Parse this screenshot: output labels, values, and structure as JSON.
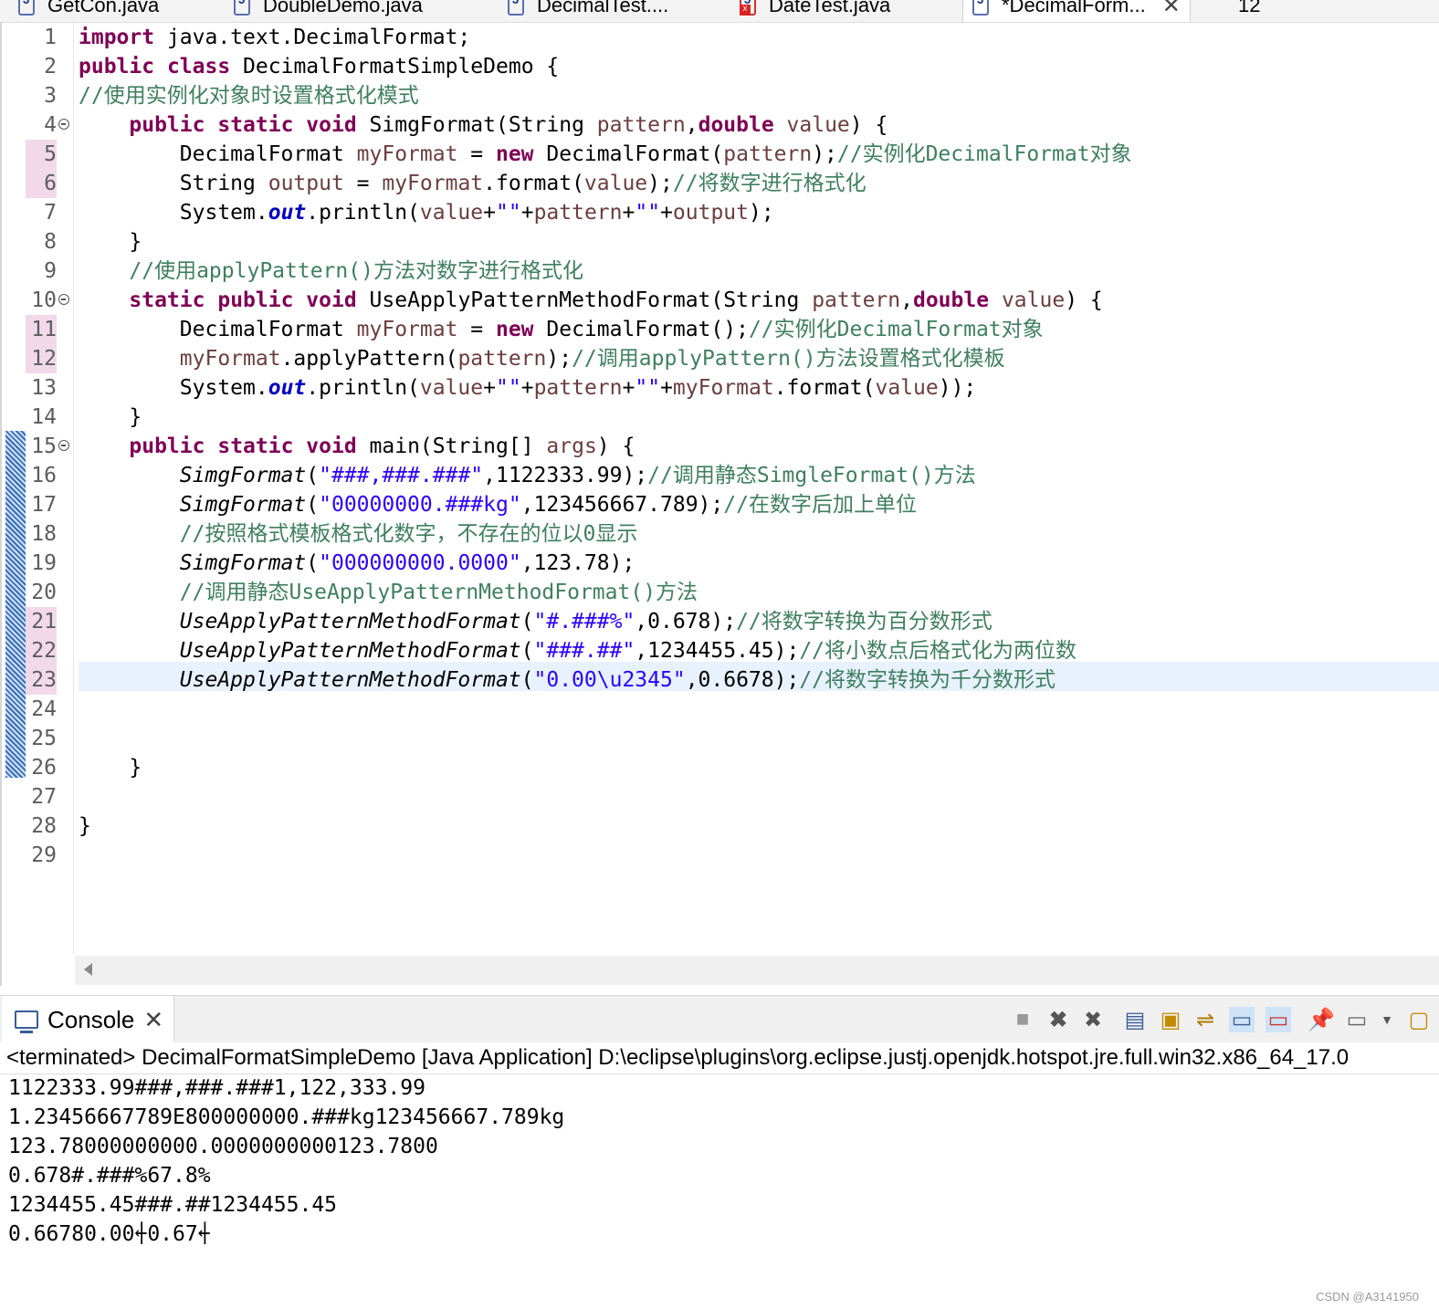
{
  "tabs": [
    {
      "label": "GetCon.java",
      "icon": "java-file-icon"
    },
    {
      "label": "DoubleDemo.java",
      "icon": "java-file-icon"
    },
    {
      "label": "DecimalTest....",
      "icon": "java-file-icon"
    },
    {
      "label": "DateTest.java",
      "icon": "java-file-error-icon"
    },
    {
      "label": "*DecimalForm...",
      "icon": "java-file-icon",
      "active": true
    },
    {
      "label": "12"
    }
  ],
  "editor": {
    "line_numbers": [
      "1",
      "2",
      "3",
      "4",
      "5",
      "6",
      "7",
      "8",
      "9",
      "10",
      "11",
      "12",
      "13",
      "14",
      "15",
      "16",
      "17",
      "18",
      "19",
      "20",
      "21",
      "22",
      "23",
      "24",
      "25",
      "26",
      "27",
      "28",
      "29"
    ],
    "code": {
      "l1": {
        "kw": "import",
        "rest": " java.text.DecimalFormat;"
      },
      "l2": {
        "kw1": "public",
        "kw2": "class",
        "rest": " DecimalFormatSimpleDemo {"
      },
      "l3": {
        "cm": "//使用实例化对象时设置格式化模式"
      },
      "l4": {
        "kw1": "public",
        "kw2": "static",
        "kw3": "void",
        "name": " SimgFormat(String ",
        "p1": "pattern",
        "comma": ",",
        "kw4": "double",
        "p2": "value",
        "end": ") {"
      },
      "l5": {
        "t1": "DecimalFormat ",
        "v": "myFormat",
        "t2": " = ",
        "kw": "new",
        "t3": " DecimalFormat(",
        "p": "pattern",
        "t4": ");",
        "cm": "//实例化DecimalFormat对象"
      },
      "l6": {
        "t1": "String ",
        "v": "output",
        "t2": " = ",
        "v2": "myFormat",
        "t3": ".format(",
        "p": "value",
        "t4": ");",
        "cm": "//将数字进行格式化"
      },
      "l7": {
        "t1": "System.",
        "fld": "out",
        "t2": ".println(",
        "p1": "value",
        "t3": "+",
        "s1": "\"\"",
        "t4": "+",
        "p2": "pattern",
        "t5": "+",
        "s2": "\"\"",
        "t6": "+",
        "v": "output",
        "t7": ");"
      },
      "l8": {
        "t": "}"
      },
      "l9": {
        "cm": "//使用applyPattern()方法对数字进行格式化"
      },
      "l10": {
        "kw1": "static",
        "kw2": "public",
        "kw3": "void",
        "name": " UseApplyPatternMethodFormat(String ",
        "p1": "pattern",
        "comma": ",",
        "kw4": "double",
        "p2": "value",
        "end": ") {"
      },
      "l11": {
        "t1": "DecimalFormat ",
        "v": "myFormat",
        "t2": " = ",
        "kw": "new",
        "t3": " DecimalFormat();",
        "cm": "//实例化DecimalFormat对象"
      },
      "l12": {
        "v": "myFormat",
        "t1": ".applyPattern(",
        "p": "pattern",
        "t2": ");",
        "cm": "//调用applyPattern()方法设置格式化模板"
      },
      "l13": {
        "t1": "System.",
        "fld": "out",
        "t2": ".println(",
        "p1": "value",
        "t3": "+",
        "s1": "\"\"",
        "t4": "+",
        "p2": "pattern",
        "t5": "+",
        "s2": "\"\"",
        "t6": "+",
        "v": "myFormat",
        "t7": ".format(",
        "p3": "value",
        "t8": "));"
      },
      "l14": {
        "t": "}"
      },
      "l15": {
        "kw1": "public",
        "kw2": "static",
        "kw3": "void",
        "name": " main(String[] ",
        "p": "args",
        "end": ") {"
      },
      "l16": {
        "fn": "SimgFormat",
        "t1": "(",
        "s": "\"###,###.###\"",
        "t2": ",1122333.99);",
        "cm": "//调用静态SimgleFormat()方法"
      },
      "l17": {
        "fn": "SimgFormat",
        "t1": "(",
        "s": "\"00000000.###kg\"",
        "t2": ",123456667.789);",
        "cm": "//在数字后加上单位"
      },
      "l18": {
        "cm": "//按照格式模板格式化数字，不存在的位以0显示"
      },
      "l19": {
        "fn": "SimgFormat",
        "t1": "(",
        "s": "\"000000000.0000\"",
        "t2": ",123.78);"
      },
      "l20": {
        "cm": "//调用静态UseApplyPatternMethodFormat()方法"
      },
      "l21": {
        "fn": "UseApplyPatternMethodFormat",
        "t1": "(",
        "s": "\"#.###%\"",
        "t2": ",0.678);",
        "cm": "//将数字转换为百分数形式"
      },
      "l22": {
        "fn": "UseApplyPatternMethodFormat",
        "t1": "(",
        "s": "\"###.##\"",
        "t2": ",1234455.45);",
        "cm": "//将小数点后格式化为两位数"
      },
      "l23": {
        "fn": "UseApplyPatternMethodFormat",
        "t1": "(",
        "s": "\"0.00\\u2345\"",
        "t2": ",0.6678);",
        "cm": "//将数字转换为千分数形式"
      },
      "l26": {
        "t": "}"
      },
      "l28": {
        "t": "}"
      }
    }
  },
  "console": {
    "tab_label": "Console",
    "status": "<terminated> DecimalFormatSimpleDemo [Java Application] D:\\eclipse\\plugins\\org.eclipse.justj.openjdk.hotspot.jre.full.win32.x86_64_17.0",
    "output": [
      "1122333.99###,###.###1,122,333.99",
      "1.23456667789E800000000.###kg123456667.789kg",
      "123.78000000000.0000000000123.7800",
      "0.678#.###%67.8%",
      "1234455.45###.##1234455.45",
      "0.66780.00⍅0.67⍅"
    ]
  },
  "watermark": "CSDN @A3141950"
}
